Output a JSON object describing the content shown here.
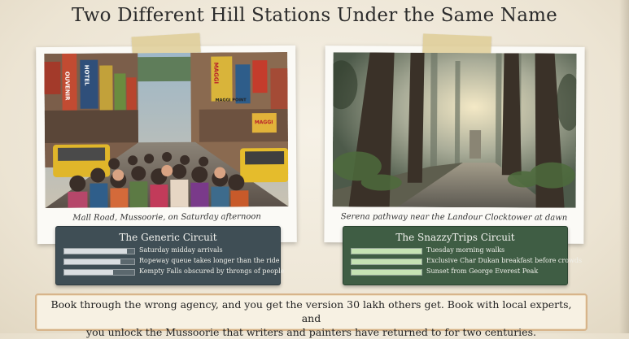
{
  "title": "Two Different Hill Stations Under the Same Name",
  "left": {
    "caption": "Mall Road, Mussoorie, on Saturday afternoon",
    "photo_signs": [
      "OUVENIR",
      "HOTEL",
      "MAGGI",
      "MAGGI POINT",
      "MAGGI"
    ],
    "panel": {
      "title": "The Generic Circuit",
      "color": "#3f4e55",
      "items": [
        {
          "label": "Saturday midday arrivals",
          "level": 0.9
        },
        {
          "label": "Ropeway queue takes longer than the ride",
          "level": 0.8
        },
        {
          "label": "Kempty Falls obscured by throngs of people",
          "level": 0.7
        }
      ]
    }
  },
  "right": {
    "caption": "Serena pathway near the Landour Clocktower at dawn",
    "panel": {
      "title": "The SnazzyTrips Circuit",
      "color": "#3f5d44",
      "items": [
        {
          "label": "Tuesday morning walks",
          "level": 1.0
        },
        {
          "label": "Exclusive Char Dukan breakfast before crowds",
          "level": 1.0
        },
        {
          "label": "Sunset from George Everest Peak",
          "level": 1.0
        }
      ]
    }
  },
  "footer": {
    "line1": "Book through the wrong agency, and you get the version 30 lakh others get. Book with local experts, and",
    "line2": "you unlock the Mussoorie that writers and painters have returned to for two centuries."
  }
}
